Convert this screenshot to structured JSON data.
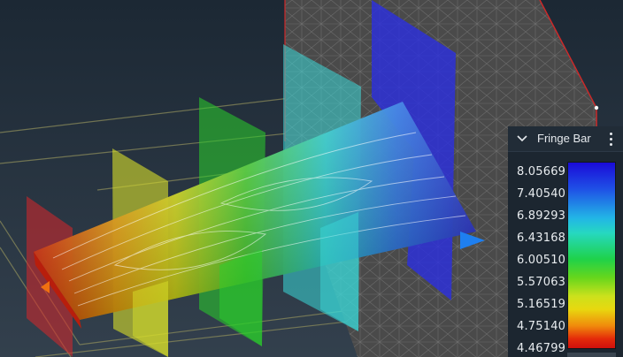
{
  "fringe_bar": {
    "title": "Fringe Bar",
    "collapse_icon": "chevron-down-icon",
    "menu_icon": "kebab-menu-icon",
    "values": [
      "8.05669",
      "7.40540",
      "6.89293",
      "6.43168",
      "6.00510",
      "5.57063",
      "5.16519",
      "4.75140",
      "4.46799"
    ],
    "gradient_colors": [
      "#1a0bd8",
      "#22b6e6",
      "#1fd24a",
      "#e8d80f",
      "#d0100c"
    ]
  },
  "viewport": {
    "background": "#24303c",
    "mesh_color": "#4c4c4c",
    "mesh_edge": "#d02828",
    "flow_arrow_color": "#1e7ff0"
  }
}
